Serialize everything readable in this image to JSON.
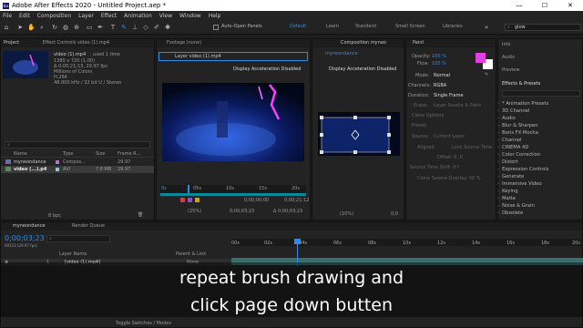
{
  "app": {
    "title": "Adobe After Effects 2020 - Untitled Project.aep *",
    "logo": "Ae"
  },
  "menu": [
    "File",
    "Edit",
    "Composition",
    "Layer",
    "Effect",
    "Animation",
    "View",
    "Window",
    "Help"
  ],
  "toolbar": {
    "auto_open_panels": "Auto-Open Panels",
    "workspaces": [
      "Default",
      "Learn",
      "Standard",
      "Small Screen",
      "Libraries"
    ],
    "search_value": "glow"
  },
  "project": {
    "tab": "Project",
    "effect_controls_tab": "Effect Controls video (1).mp4",
    "clip_name": "video (1).mp4",
    "clip_used": ", used 1 time",
    "clip_info": [
      "1380 x 720 (1.00)",
      "Δ 0;00;21;13, 29.97 fps",
      "Millions of Colors",
      "H.264",
      "48.000 kHz / 32 bit U / Stereo"
    ],
    "search_placeholder": "⌕",
    "columns": [
      "Name",
      "Type",
      "Size",
      "Frame R..."
    ],
    "rows": [
      {
        "name": "myneondance",
        "type": "Compos...",
        "size": "",
        "fps": "29.97"
      },
      {
        "name": "video (...).p4",
        "type": "AVI",
        "size": "7.8 MB",
        "fps": "29.97"
      }
    ],
    "bpc": "8 bpc"
  },
  "footage": {
    "tab": "Footage (none)"
  },
  "layer": {
    "tab": "Layer video (1).mp4",
    "accel": "Display Acceleration Disabled",
    "ruler": [
      "0s",
      "05s",
      "10s",
      "15s",
      "20s"
    ],
    "time_a": "0;00;00;00",
    "time_b": "0;00;21;12",
    "zoom": "(25%)",
    "timecode": "0;00;03;23",
    "delta": "Δ 0;00;03;23"
  },
  "composition": {
    "tab": "Composition myneo",
    "comp_tab": "myneondance",
    "accel": "Display Acceleration Disabled",
    "zoom": "(10%)",
    "res": "0;0"
  },
  "paint": {
    "tab": "Paint",
    "opacity_label": "Opacity:",
    "opacity": "100 %",
    "flow_label": "Flow:",
    "flow": "100 %",
    "mode_label": "Mode:",
    "mode": "Normal",
    "channels_label": "Channels:",
    "channels": "RGBA",
    "duration_label": "Duration:",
    "duration": "Single Frame",
    "erase_label": "Erase:",
    "erase": "Layer Source & Paint",
    "clone_label": "Clone Options",
    "preset_label": "Preset:",
    "source_label": "Source:",
    "source": "Current Layer",
    "aligned": "Aligned",
    "lock_source": "Lock Source Time",
    "offset": "Offset: 0, 0",
    "source_time_shift": "Source Time Shift: 0 f",
    "clone_overlay": "Clone Source Overlay: 50 %",
    "fg_color": "#e040e0",
    "bg_color": "#ffffff"
  },
  "right": {
    "info": "Info",
    "audio": "Audio",
    "preview": "Preview",
    "effects_tab": "Effects & Presets",
    "effects": [
      "* Animation Presets",
      "3D Channel",
      "Audio",
      "Blur & Sharpen",
      "Boris FX Mocha",
      "Channel",
      "CINEMA 4D",
      "Color Correction",
      "Distort",
      "Expression Controls",
      "Generate",
      "Immersive Video",
      "Keying",
      "Matte",
      "Noise & Grain",
      "Obsolete"
    ]
  },
  "timeline": {
    "comp_tab": "myneondance",
    "render_queue": "Render Queue",
    "timecode": "0;00;03;23",
    "timecode_sub": "00113 (29.97 fps)",
    "search_placeholder": "⌕",
    "columns": [
      "Layer Name",
      "Parent & Link"
    ],
    "layer_num": "1",
    "layer_name": "[video (1).mp4]",
    "parent": "None",
    "ticks": [
      "00s",
      "02s",
      "04s",
      "06s",
      "08s",
      "10s",
      "12s",
      "14s",
      "16s",
      "18s",
      "20s"
    ],
    "toggle": "Toggle Switches / Modes"
  },
  "caption": {
    "line1": "repeat brush drawing and",
    "line2": "click page down butten"
  }
}
